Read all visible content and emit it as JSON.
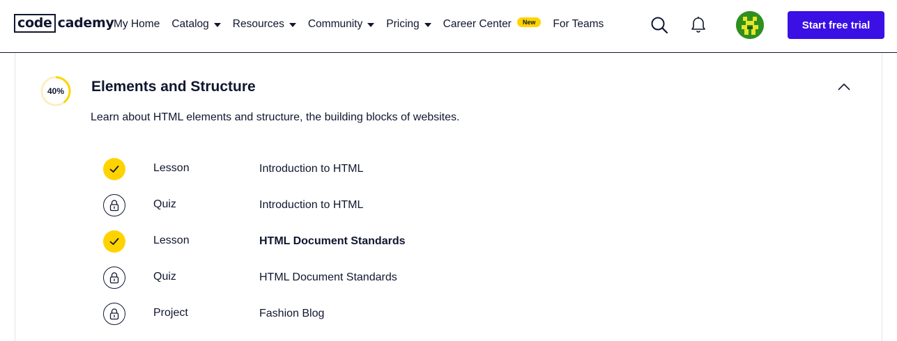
{
  "brand": {
    "logo_part1": "code",
    "logo_part2": "cademy"
  },
  "nav": {
    "items": [
      {
        "label": "My Home",
        "dropdown": false
      },
      {
        "label": "Catalog",
        "dropdown": true
      },
      {
        "label": "Resources",
        "dropdown": true
      },
      {
        "label": "Community",
        "dropdown": true
      },
      {
        "label": "Pricing",
        "dropdown": true
      },
      {
        "label": "Career Center",
        "dropdown": false,
        "badge": "New"
      },
      {
        "label": "For Teams",
        "dropdown": false
      }
    ],
    "search_icon": "search-icon",
    "notifications_icon": "bell-icon",
    "cta_label": "Start free trial"
  },
  "colors": {
    "brand_blue": "#3a10e5",
    "accent_yellow": "#ffd300",
    "navy": "#10162f",
    "avatar_green": "#2f8f1f"
  },
  "module": {
    "progress_percent": 40,
    "progress_label": "40%",
    "title": "Elements and Structure",
    "description": "Learn about HTML elements and structure, the building blocks of websites.",
    "collapse_icon": "chevron-up-icon",
    "items": [
      {
        "type": "Lesson",
        "title": "Introduction to HTML",
        "status": "completed",
        "current": false
      },
      {
        "type": "Quiz",
        "title": "Introduction to HTML",
        "status": "locked",
        "current": false
      },
      {
        "type": "Lesson",
        "title": "HTML Document Standards",
        "status": "completed",
        "current": true
      },
      {
        "type": "Quiz",
        "title": "HTML Document Standards",
        "status": "locked",
        "current": false
      },
      {
        "type": "Project",
        "title": "Fashion Blog",
        "status": "locked",
        "current": false
      }
    ]
  }
}
